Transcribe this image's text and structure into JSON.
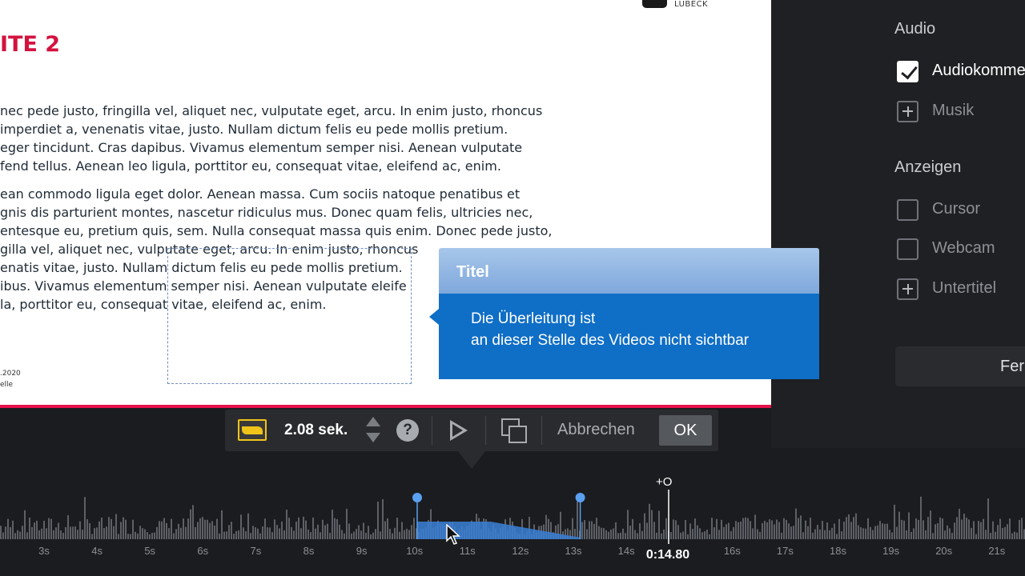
{
  "slide": {
    "title": "ITE 2",
    "logo_text": "LÜBECK",
    "paragraph1": [
      "nec pede justo, fringilla vel, aliquet nec, vulputate eget, arcu. In enim justo, rhoncus",
      "imperdiet a, venenatis vitae, justo. Nullam dictum felis eu pede mollis pretium.",
      "eger tincidunt. Cras dapibus. Vivamus elementum semper nisi. Aenean vulputate",
      "fend tellus. Aenean leo ligula, porttitor eu, consequat vitae, eleifend ac, enim."
    ],
    "paragraph2": [
      "ean commodo ligula eget dolor. Aenean massa. Cum sociis natoque penatibus et",
      "gnis dis parturient montes, nascetur ridiculus mus. Donec quam felis, ultricies nec,",
      "entesque eu, pretium quis, sem. Nulla consequat massa quis enim. Donec pede justo,",
      "gilla vel, aliquet nec, vulputate eget, arcu. In enim justo, rhoncus",
      "enatis vitae, justo. Nullam dictum felis eu pede mollis pretium.",
      "ibus. Vivamus elementum semper nisi. Aenean vulputate eleife",
      "la, porttitor eu, consequat vitae, eleifend ac, enim."
    ],
    "footer_line1": ".2020",
    "footer_line2": "elle"
  },
  "panel": {
    "audio_heading": "Audio",
    "audio_items": [
      {
        "label": "Audiokommentar",
        "state": "checked"
      },
      {
        "label": "Musik",
        "state": "add"
      }
    ],
    "anzeigen_heading": "Anzeigen",
    "anzeigen_items": [
      {
        "label": "Cursor",
        "state": "unchecked"
      },
      {
        "label": "Webcam",
        "state": "unchecked"
      },
      {
        "label": "Untertitel",
        "state": "add"
      }
    ],
    "finish_label": "Fer"
  },
  "tooltip": {
    "title": "Titel",
    "line1": "Die Überleitung ist",
    "line2": "an dieser Stelle des Videos nicht sichtbar"
  },
  "toolbar": {
    "duration": "2.08 sek.",
    "help": "?",
    "cancel_label": "Abbrechen",
    "ok_label": "OK"
  },
  "timeline": {
    "ticks": [
      "3s",
      "4s",
      "5s",
      "6s",
      "7s",
      "8s",
      "9s",
      "10s",
      "11s",
      "12s",
      "13s",
      "14s",
      "15s",
      "16s",
      "17s",
      "18s",
      "19s",
      "20s",
      "21s"
    ],
    "current_time": "0:14.80",
    "marker_label": "+O",
    "transition_start_s": 10.05,
    "transition_end_s": 13.13,
    "colors": {
      "waveform": "#5d6066",
      "selection": "#3a7fd6",
      "handle": "#5aa0f0"
    }
  }
}
